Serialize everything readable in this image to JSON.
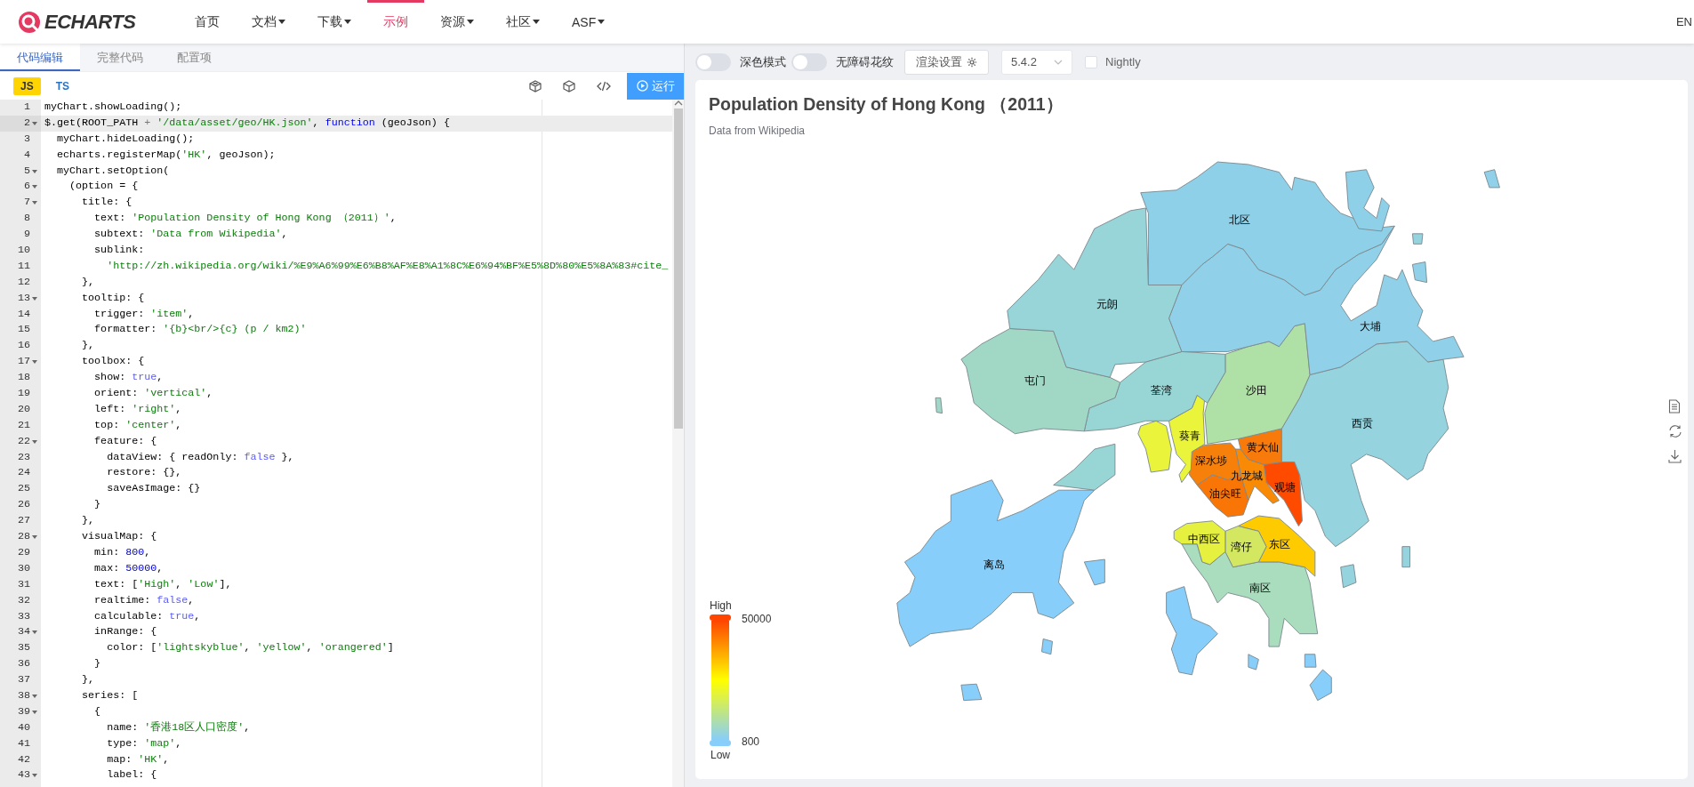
{
  "nav": {
    "logo": "ECHARTS",
    "items": [
      {
        "label": "首页",
        "dropdown": false,
        "selected": false
      },
      {
        "label": "文档",
        "dropdown": true,
        "selected": false
      },
      {
        "label": "下载",
        "dropdown": true,
        "selected": false
      },
      {
        "label": "示例",
        "dropdown": false,
        "selected": true
      },
      {
        "label": "资源",
        "dropdown": true,
        "selected": false
      },
      {
        "label": "社区",
        "dropdown": true,
        "selected": false
      },
      {
        "label": "ASF",
        "dropdown": true,
        "selected": false
      }
    ],
    "lang": "EN"
  },
  "editor": {
    "tabs": [
      {
        "label": "代码编辑",
        "selected": true
      },
      {
        "label": "完整代码",
        "selected": false
      },
      {
        "label": "配置项",
        "selected": false
      }
    ],
    "languages": [
      {
        "label": "JS",
        "selected": true
      },
      {
        "label": "TS",
        "selected": false
      }
    ],
    "run_button": "运行",
    "lines": [
      {
        "number": "1",
        "foldable": false,
        "active": false,
        "tokens": [
          {
            "kind": "plain",
            "text": "myChart.showLoading();"
          }
        ]
      },
      {
        "number": "2",
        "foldable": true,
        "active": true,
        "tokens": [
          {
            "kind": "plain",
            "text": "$.get(ROOT_PATH "
          },
          {
            "kind": "operator",
            "text": "+"
          },
          {
            "kind": "string",
            "text": " '/data/asset/geo/HK.json'"
          },
          {
            "kind": "plain",
            "text": ", "
          },
          {
            "kind": "keyword",
            "text": "function"
          },
          {
            "kind": "plain",
            "text": " (geoJson) {"
          }
        ]
      },
      {
        "number": "3",
        "foldable": false,
        "active": false,
        "tokens": [
          {
            "kind": "plain",
            "text": "  myChart.hideLoading();"
          }
        ]
      },
      {
        "number": "4",
        "foldable": false,
        "active": false,
        "tokens": [
          {
            "kind": "plain",
            "text": "  echarts.registerMap("
          },
          {
            "kind": "string",
            "text": "'HK'"
          },
          {
            "kind": "plain",
            "text": ", geoJson);"
          }
        ]
      },
      {
        "number": "5",
        "foldable": true,
        "active": false,
        "tokens": [
          {
            "kind": "plain",
            "text": "  myChart.setOption("
          }
        ]
      },
      {
        "number": "6",
        "foldable": true,
        "active": false,
        "tokens": [
          {
            "kind": "plain",
            "text": "    (option = {"
          }
        ]
      },
      {
        "number": "7",
        "foldable": true,
        "active": false,
        "tokens": [
          {
            "kind": "plain",
            "text": "      title: {"
          }
        ]
      },
      {
        "number": "8",
        "foldable": false,
        "active": false,
        "tokens": [
          {
            "kind": "plain",
            "text": "        text: "
          },
          {
            "kind": "string",
            "text": "'Population Density of Hong Kong （2011）'"
          },
          {
            "kind": "plain",
            "text": ","
          }
        ]
      },
      {
        "number": "9",
        "foldable": false,
        "active": false,
        "tokens": [
          {
            "kind": "plain",
            "text": "        subtext: "
          },
          {
            "kind": "string",
            "text": "'Data from Wikipedia'"
          },
          {
            "kind": "plain",
            "text": ","
          }
        ]
      },
      {
        "number": "10",
        "foldable": false,
        "active": false,
        "tokens": [
          {
            "kind": "plain",
            "text": "        sublink:"
          }
        ]
      },
      {
        "number": "11",
        "foldable": false,
        "active": false,
        "tokens": [
          {
            "kind": "string",
            "text": "          'http://zh.wikipedia.org/wiki/%E9%A6%99%E6%B8%AF%E8%A1%8C%E6%94%BF%E5%8D%80%E5%8A%83#cite_"
          }
        ]
      },
      {
        "number": "12",
        "foldable": false,
        "active": false,
        "tokens": [
          {
            "kind": "plain",
            "text": "      },"
          }
        ]
      },
      {
        "number": "13",
        "foldable": true,
        "active": false,
        "tokens": [
          {
            "kind": "plain",
            "text": "      tooltip: {"
          }
        ]
      },
      {
        "number": "14",
        "foldable": false,
        "active": false,
        "tokens": [
          {
            "kind": "plain",
            "text": "        trigger: "
          },
          {
            "kind": "string",
            "text": "'item'"
          },
          {
            "kind": "plain",
            "text": ","
          }
        ]
      },
      {
        "number": "15",
        "foldable": false,
        "active": false,
        "tokens": [
          {
            "kind": "plain",
            "text": "        formatter: "
          },
          {
            "kind": "string",
            "text": "'{b}<br/>{c} (p / km2)'"
          }
        ]
      },
      {
        "number": "16",
        "foldable": false,
        "active": false,
        "tokens": [
          {
            "kind": "plain",
            "text": "      },"
          }
        ]
      },
      {
        "number": "17",
        "foldable": true,
        "active": false,
        "tokens": [
          {
            "kind": "plain",
            "text": "      toolbox: {"
          }
        ]
      },
      {
        "number": "18",
        "foldable": false,
        "active": false,
        "tokens": [
          {
            "kind": "plain",
            "text": "        show: "
          },
          {
            "kind": "constant",
            "text": "true"
          },
          {
            "kind": "plain",
            "text": ","
          }
        ]
      },
      {
        "number": "19",
        "foldable": false,
        "active": false,
        "tokens": [
          {
            "kind": "plain",
            "text": "        orient: "
          },
          {
            "kind": "string",
            "text": "'vertical'"
          },
          {
            "kind": "plain",
            "text": ","
          }
        ]
      },
      {
        "number": "20",
        "foldable": false,
        "active": false,
        "tokens": [
          {
            "kind": "plain",
            "text": "        left: "
          },
          {
            "kind": "string",
            "text": "'right'"
          },
          {
            "kind": "plain",
            "text": ","
          }
        ]
      },
      {
        "number": "21",
        "foldable": false,
        "active": false,
        "tokens": [
          {
            "kind": "plain",
            "text": "        top: "
          },
          {
            "kind": "string",
            "text": "'center'"
          },
          {
            "kind": "plain",
            "text": ","
          }
        ]
      },
      {
        "number": "22",
        "foldable": true,
        "active": false,
        "tokens": [
          {
            "kind": "plain",
            "text": "        feature: {"
          }
        ]
      },
      {
        "number": "23",
        "foldable": false,
        "active": false,
        "tokens": [
          {
            "kind": "plain",
            "text": "          dataView: { readOnly: "
          },
          {
            "kind": "constant",
            "text": "false"
          },
          {
            "kind": "plain",
            "text": " },"
          }
        ]
      },
      {
        "number": "24",
        "foldable": false,
        "active": false,
        "tokens": [
          {
            "kind": "plain",
            "text": "          restore: {},"
          }
        ]
      },
      {
        "number": "25",
        "foldable": false,
        "active": false,
        "tokens": [
          {
            "kind": "plain",
            "text": "          saveAsImage: {}"
          }
        ]
      },
      {
        "number": "26",
        "foldable": false,
        "active": false,
        "tokens": [
          {
            "kind": "plain",
            "text": "        }"
          }
        ]
      },
      {
        "number": "27",
        "foldable": false,
        "active": false,
        "tokens": [
          {
            "kind": "plain",
            "text": "      },"
          }
        ]
      },
      {
        "number": "28",
        "foldable": true,
        "active": false,
        "tokens": [
          {
            "kind": "plain",
            "text": "      visualMap: {"
          }
        ]
      },
      {
        "number": "29",
        "foldable": false,
        "active": false,
        "tokens": [
          {
            "kind": "plain",
            "text": "        min: "
          },
          {
            "kind": "number",
            "text": "800"
          },
          {
            "kind": "plain",
            "text": ","
          }
        ]
      },
      {
        "number": "30",
        "foldable": false,
        "active": false,
        "tokens": [
          {
            "kind": "plain",
            "text": "        max: "
          },
          {
            "kind": "number",
            "text": "50000"
          },
          {
            "kind": "plain",
            "text": ","
          }
        ]
      },
      {
        "number": "31",
        "foldable": false,
        "active": false,
        "tokens": [
          {
            "kind": "plain",
            "text": "        text: ["
          },
          {
            "kind": "string",
            "text": "'High'"
          },
          {
            "kind": "plain",
            "text": ", "
          },
          {
            "kind": "string",
            "text": "'Low'"
          },
          {
            "kind": "plain",
            "text": "],"
          }
        ]
      },
      {
        "number": "32",
        "foldable": false,
        "active": false,
        "tokens": [
          {
            "kind": "plain",
            "text": "        realtime: "
          },
          {
            "kind": "constant",
            "text": "false"
          },
          {
            "kind": "plain",
            "text": ","
          }
        ]
      },
      {
        "number": "33",
        "foldable": false,
        "active": false,
        "tokens": [
          {
            "kind": "plain",
            "text": "        calculable: "
          },
          {
            "kind": "constant",
            "text": "true"
          },
          {
            "kind": "plain",
            "text": ","
          }
        ]
      },
      {
        "number": "34",
        "foldable": true,
        "active": false,
        "tokens": [
          {
            "kind": "plain",
            "text": "        inRange: {"
          }
        ]
      },
      {
        "number": "35",
        "foldable": false,
        "active": false,
        "tokens": [
          {
            "kind": "plain",
            "text": "          color: ["
          },
          {
            "kind": "string",
            "text": "'lightskyblue'"
          },
          {
            "kind": "plain",
            "text": ", "
          },
          {
            "kind": "string",
            "text": "'yellow'"
          },
          {
            "kind": "plain",
            "text": ", "
          },
          {
            "kind": "string",
            "text": "'orangered'"
          },
          {
            "kind": "plain",
            "text": "]"
          }
        ]
      },
      {
        "number": "36",
        "foldable": false,
        "active": false,
        "tokens": [
          {
            "kind": "plain",
            "text": "        }"
          }
        ]
      },
      {
        "number": "37",
        "foldable": false,
        "active": false,
        "tokens": [
          {
            "kind": "plain",
            "text": "      },"
          }
        ]
      },
      {
        "number": "38",
        "foldable": true,
        "active": false,
        "tokens": [
          {
            "kind": "plain",
            "text": "      series: ["
          }
        ]
      },
      {
        "number": "39",
        "foldable": true,
        "active": false,
        "tokens": [
          {
            "kind": "plain",
            "text": "        {"
          }
        ]
      },
      {
        "number": "40",
        "foldable": false,
        "active": false,
        "tokens": [
          {
            "kind": "plain",
            "text": "          name: "
          },
          {
            "kind": "string",
            "text": "'香港18区人口密度'"
          },
          {
            "kind": "plain",
            "text": ","
          }
        ]
      },
      {
        "number": "41",
        "foldable": false,
        "active": false,
        "tokens": [
          {
            "kind": "plain",
            "text": "          type: "
          },
          {
            "kind": "string",
            "text": "'map'"
          },
          {
            "kind": "plain",
            "text": ","
          }
        ]
      },
      {
        "number": "42",
        "foldable": false,
        "active": false,
        "tokens": [
          {
            "kind": "plain",
            "text": "          map: "
          },
          {
            "kind": "string",
            "text": "'HK'"
          },
          {
            "kind": "plain",
            "text": ","
          }
        ]
      },
      {
        "number": "43",
        "foldable": true,
        "active": false,
        "tokens": [
          {
            "kind": "plain",
            "text": "          label: {"
          }
        ]
      }
    ]
  },
  "preview": {
    "toggles": [
      {
        "label": "深色模式",
        "on": false
      },
      {
        "label": "无障碍花纹",
        "on": false
      }
    ],
    "render_button": "渲染设置",
    "version": "5.4.2",
    "nightly": {
      "label": "Nightly",
      "checked": false
    },
    "chart": {
      "title": "Population Density of Hong Kong （2011）",
      "subtitle": "Data from Wikipedia",
      "districts": [
        {
          "name": "北区",
          "color": "#8fd0e9"
        },
        {
          "name": "元朗",
          "color": "#97d5d9"
        },
        {
          "name": "大埔",
          "color": "#90d0e8"
        },
        {
          "name": "屯门",
          "color": "#a0d8c5"
        },
        {
          "name": "荃湾",
          "color": "#98d5d5"
        },
        {
          "name": "沙田",
          "color": "#afe0a5"
        },
        {
          "name": "西贡",
          "color": "#95d3de"
        },
        {
          "name": "葵青",
          "color": "#e9f43a"
        },
        {
          "name": "黄大仙",
          "color": "#f77a0a"
        },
        {
          "name": "深水埗",
          "color": "#f7800a"
        },
        {
          "name": "九龙城",
          "color": "#f88a06"
        },
        {
          "name": "观塘",
          "color": "#ff4b00"
        },
        {
          "name": "油尖旺",
          "color": "#f97506"
        },
        {
          "name": "中西区",
          "color": "#e6f03f"
        },
        {
          "name": "湾仔",
          "color": "#d3e860"
        },
        {
          "name": "东区",
          "color": "#fecb00"
        },
        {
          "name": "离岛",
          "color": "#87cefa"
        },
        {
          "name": "南区",
          "color": "#a9ddbd"
        }
      ],
      "legend": {
        "high_label": "High",
        "max": "50000",
        "min": "800",
        "low_label": "Low"
      }
    }
  }
}
